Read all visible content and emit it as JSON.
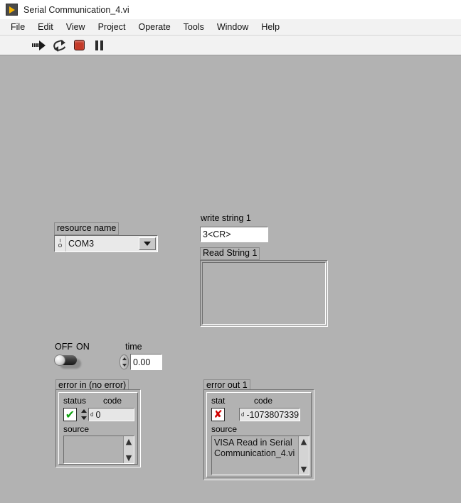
{
  "window": {
    "title": "Serial Communication_4.vi",
    "vi_icon": "labview-vi-icon"
  },
  "menubar": {
    "items": [
      {
        "label": "File"
      },
      {
        "label": "Edit"
      },
      {
        "label": "View"
      },
      {
        "label": "Project"
      },
      {
        "label": "Operate"
      },
      {
        "label": "Tools"
      },
      {
        "label": "Window"
      },
      {
        "label": "Help"
      }
    ]
  },
  "toolbar": {
    "buttons": [
      {
        "name": "run-button",
        "icon": "run-arrow-icon"
      },
      {
        "name": "run-continuously-button",
        "icon": "run-continuously-icon"
      },
      {
        "name": "abort-execution-button",
        "icon": "stop-octagon-icon"
      },
      {
        "name": "pause-button",
        "icon": "pause-icon"
      }
    ]
  },
  "panel": {
    "resource_name": {
      "label": "resource name",
      "value": "COM3",
      "glyph_top": "I",
      "glyph_bottom": "O",
      "dropdown_icon": "chevron-down-icon"
    },
    "write_string": {
      "label": "write string 1",
      "value": "3<CR>"
    },
    "read_string": {
      "label": "Read String 1",
      "value": ""
    },
    "switch": {
      "off_label": "OFF",
      "on_label": "ON",
      "state": "OFF"
    },
    "time": {
      "label": "time",
      "value": "0.00"
    },
    "error_in": {
      "label": "error in (no error)",
      "status_label": "status",
      "status_icon": "green-check-icon",
      "code_label": "code",
      "code_prefix": "d",
      "code_value": "0",
      "source_label": "source",
      "source_value": "",
      "scroll_up_icon": "chevron-up-icon",
      "scroll_down_icon": "chevron-down-icon"
    },
    "error_out": {
      "label": "error out 1",
      "status_label": "stat",
      "status_icon": "red-x-icon",
      "code_label": "code",
      "code_prefix": "d",
      "code_value": "-1073807339",
      "source_label": "source",
      "source_value": "VISA Read in Serial Communication_4.vi",
      "scroll_up_icon": "chevron-up-icon",
      "scroll_down_icon": "chevron-down-icon"
    }
  },
  "colors": {
    "panel_background": "#b2b2b2",
    "titlebar_background": "#ffffff",
    "menubar_background": "#f2f2f2",
    "error_status_ok": "#0fa30f",
    "error_status_error": "#d00000",
    "vi_icon_accent": "#f5b301",
    "abort_button": "#c43a28"
  }
}
